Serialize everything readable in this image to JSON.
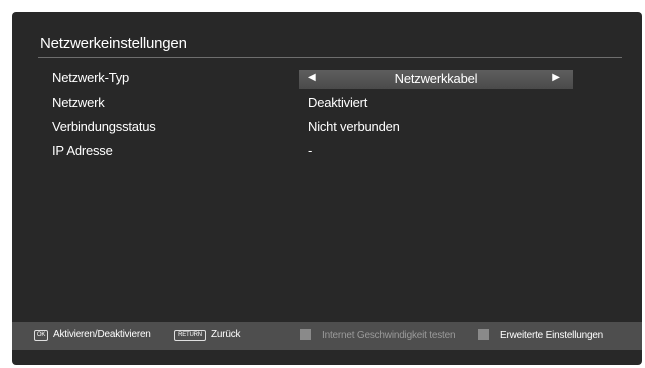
{
  "window": {
    "title": "Netzwerkeinstellungen"
  },
  "settings": [
    {
      "label": "Netzwerk-Typ",
      "value": "Netzwerkkabel"
    },
    {
      "label": "Netzwerk",
      "value": "Deaktiviert"
    },
    {
      "label": "Verbindungsstatus",
      "value": "Nicht verbunden"
    },
    {
      "label": "IP Adresse",
      "value": "-"
    }
  ],
  "selector": {
    "left_arrow": "◀",
    "right_arrow": "▶"
  },
  "footer": {
    "ok_key": "OK",
    "ok_label": "Aktivieren/Deaktivieren",
    "return_key": "RETURN",
    "return_label": "Zurück",
    "speedtest_label": "Internet Geschwindigkeit testen",
    "advanced_label": "Erweiterte Einstellungen"
  },
  "colors": {
    "panel": "#282828",
    "footer": "#4e4e4e",
    "selector": "#555555"
  }
}
